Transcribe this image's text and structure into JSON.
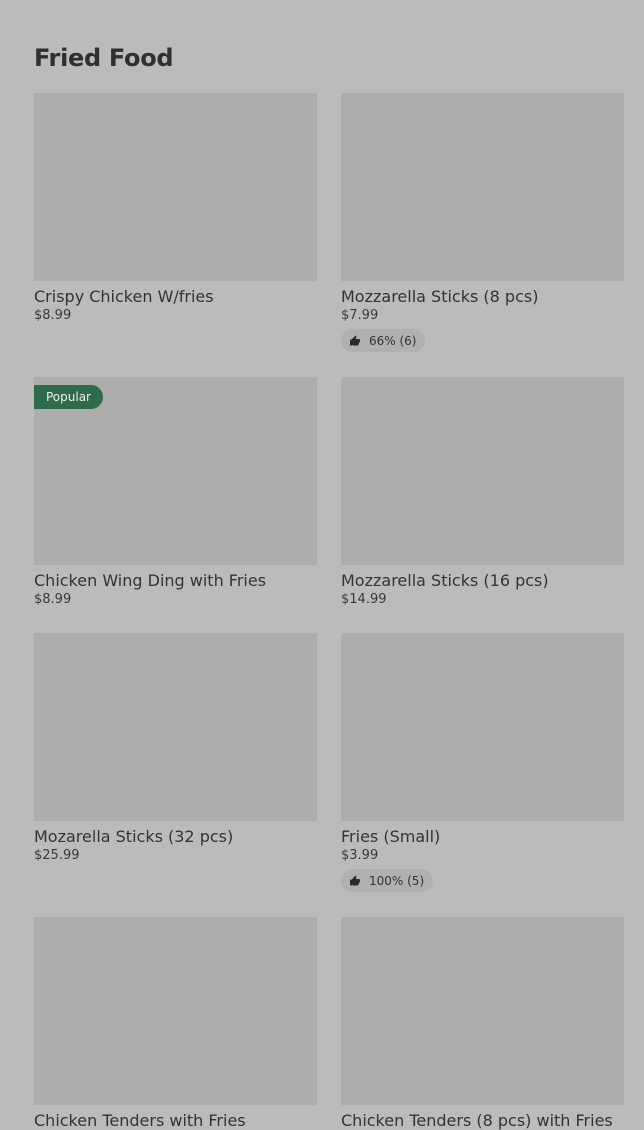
{
  "section": {
    "title": "Fried Food"
  },
  "items": [
    {
      "name": "Crispy Chicken W/fries",
      "price": "$8.99",
      "badge": "",
      "rating": ""
    },
    {
      "name": "Mozzarella Sticks (8 pcs)",
      "price": "$7.99",
      "badge": "",
      "rating": "66% (6)"
    },
    {
      "name": "Chicken Wing Ding with Fries",
      "price": "$8.99",
      "badge": "Popular",
      "rating": ""
    },
    {
      "name": "Mozzarella Sticks (16 pcs)",
      "price": "$14.99",
      "badge": "",
      "rating": ""
    },
    {
      "name": "Mozarella Sticks (32 pcs)",
      "price": "$25.99",
      "badge": "",
      "rating": ""
    },
    {
      "name": "Fries (Small)",
      "price": "$3.99",
      "badge": "",
      "rating": "100% (5)"
    },
    {
      "name": "Chicken Tenders with Fries",
      "price": "",
      "badge": "",
      "rating": ""
    },
    {
      "name": "Chicken Tenders (8 pcs) with Fries",
      "price": "",
      "badge": "",
      "rating": ""
    }
  ],
  "icons": {
    "rating": "thumbs-up-icon"
  },
  "colors": {
    "background": "#bbbbbb",
    "image_placeholder": "#adadad",
    "popular_badge": "#2f6b4a"
  }
}
